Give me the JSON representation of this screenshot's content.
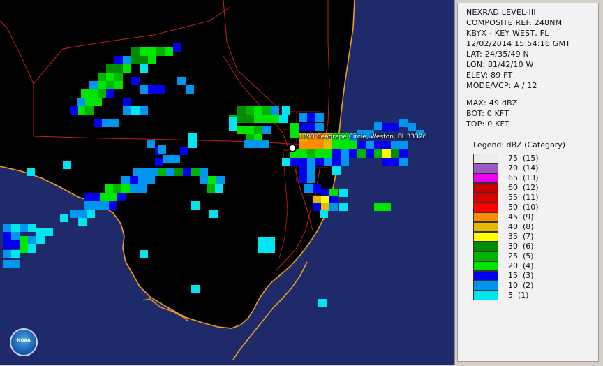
{
  "header": {
    "product": "NEXRAD LEVEL-III",
    "composite": "COMPOSITE REF. 248NM",
    "station": "KBYX - KEY WEST, FL",
    "datetime": "12/02/2014 15:54:16 GMT",
    "lat": "LAT: 24/35/49 N",
    "lon": "LON: 81/42/10 W",
    "elev": "ELEV: 89 FT",
    "mode": "MODE/VCP: A / 12",
    "max": "MAX: 49 dBZ",
    "bot": "BOT: 0 KFT",
    "top": "TOP: 0 KFT"
  },
  "legend": {
    "title": "Legend: dBZ (Category)",
    "items": [
      {
        "label": "75  (15)",
        "color": "#ececec"
      },
      {
        "label": "70  (14)",
        "color": "#9b59c6"
      },
      {
        "label": "65  (13)",
        "color": "#f000f0"
      },
      {
        "label": "60  (12)",
        "color": "#c80000"
      },
      {
        "label": "55  (11)",
        "color": "#d80000"
      },
      {
        "label": "50  (10)",
        "color": "#ff0000"
      },
      {
        "label": "45  (9)",
        "color": "#ff8c00"
      },
      {
        "label": "40  (8)",
        "color": "#e6b800"
      },
      {
        "label": "35  (7)",
        "color": "#ffff00"
      },
      {
        "label": "30  (6)",
        "color": "#008c00"
      },
      {
        "label": "25  (5)",
        "color": "#00b400"
      },
      {
        "label": "20  (4)",
        "color": "#00e600"
      },
      {
        "label": "15  (3)",
        "color": "#0000f0"
      },
      {
        "label": "10  (2)",
        "color": "#0096f0"
      },
      {
        "label": "5  (1)",
        "color": "#00e6f0"
      }
    ]
  },
  "map": {
    "address": "1393 Seagrape Circle, Weston, FL 33326",
    "logo_text": "NOAA",
    "background_color": "#1e2a6a",
    "land_color": "#000000",
    "coast_color": "#f0a020",
    "road_color": "#c81e1e"
  }
}
